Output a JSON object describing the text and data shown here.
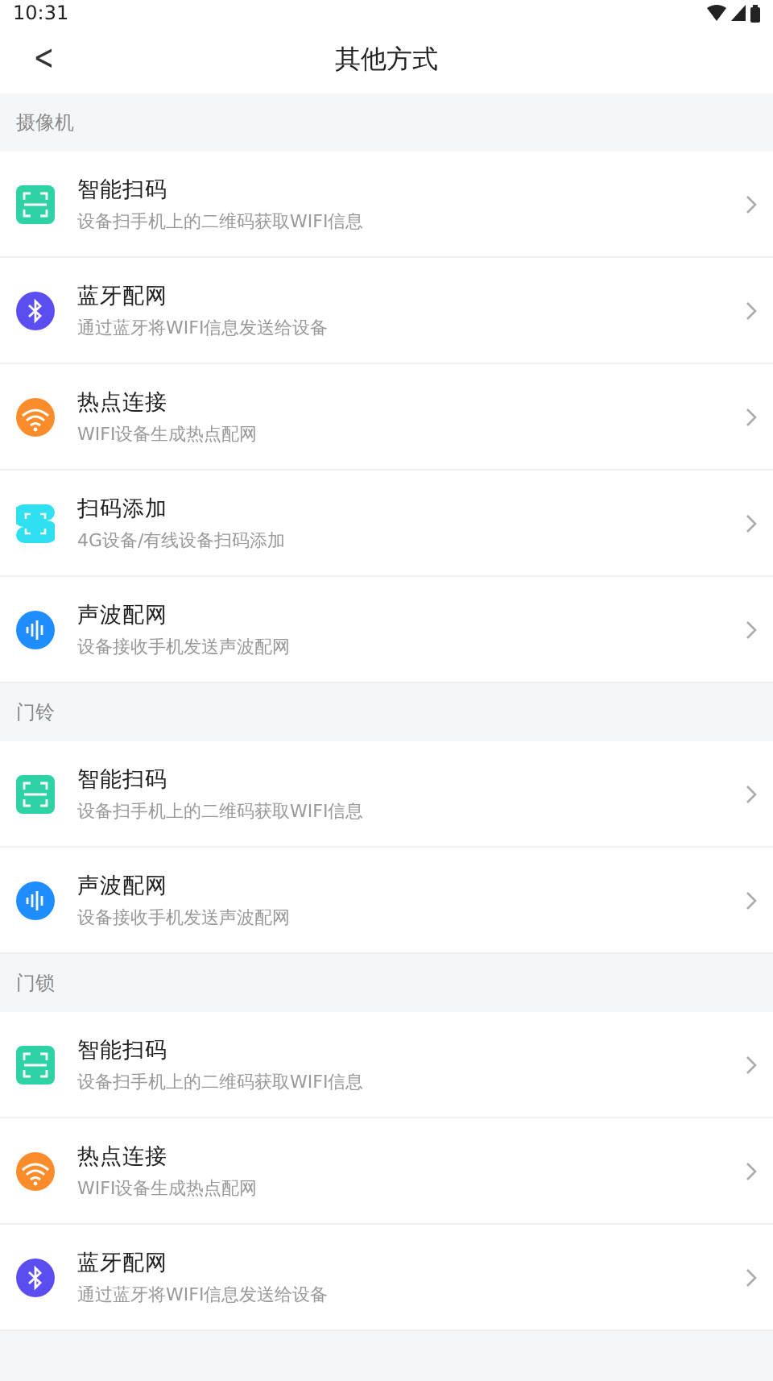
{
  "status_bar": {
    "time": "10:31"
  },
  "header": {
    "back": "<",
    "title": "其他方式"
  },
  "sections": [
    {
      "title": "摄像机",
      "items": [
        {
          "kind": "scan",
          "title": "智能扫码",
          "subtitle": "设备扫手机上的二维码获取WIFI信息"
        },
        {
          "kind": "bluetooth",
          "title": "蓝牙配网",
          "subtitle": "通过蓝牙将WIFI信息发送给设备"
        },
        {
          "kind": "hotspot",
          "title": "热点连接",
          "subtitle": "WIFI设备生成热点配网"
        },
        {
          "kind": "scanadd",
          "title": "扫码添加",
          "subtitle": "4G设备/有线设备扫码添加"
        },
        {
          "kind": "sound",
          "title": "声波配网",
          "subtitle": "设备接收手机发送声波配网"
        }
      ]
    },
    {
      "title": "门铃",
      "items": [
        {
          "kind": "scan",
          "title": "智能扫码",
          "subtitle": "设备扫手机上的二维码获取WIFI信息"
        },
        {
          "kind": "sound",
          "title": "声波配网",
          "subtitle": "设备接收手机发送声波配网"
        }
      ]
    },
    {
      "title": "门锁",
      "items": [
        {
          "kind": "scan",
          "title": "智能扫码",
          "subtitle": "设备扫手机上的二维码获取WIFI信息"
        },
        {
          "kind": "hotspot",
          "title": "热点连接",
          "subtitle": "WIFI设备生成热点配网"
        },
        {
          "kind": "bluetooth",
          "title": "蓝牙配网",
          "subtitle": "通过蓝牙将WIFI信息发送给设备"
        }
      ]
    }
  ]
}
